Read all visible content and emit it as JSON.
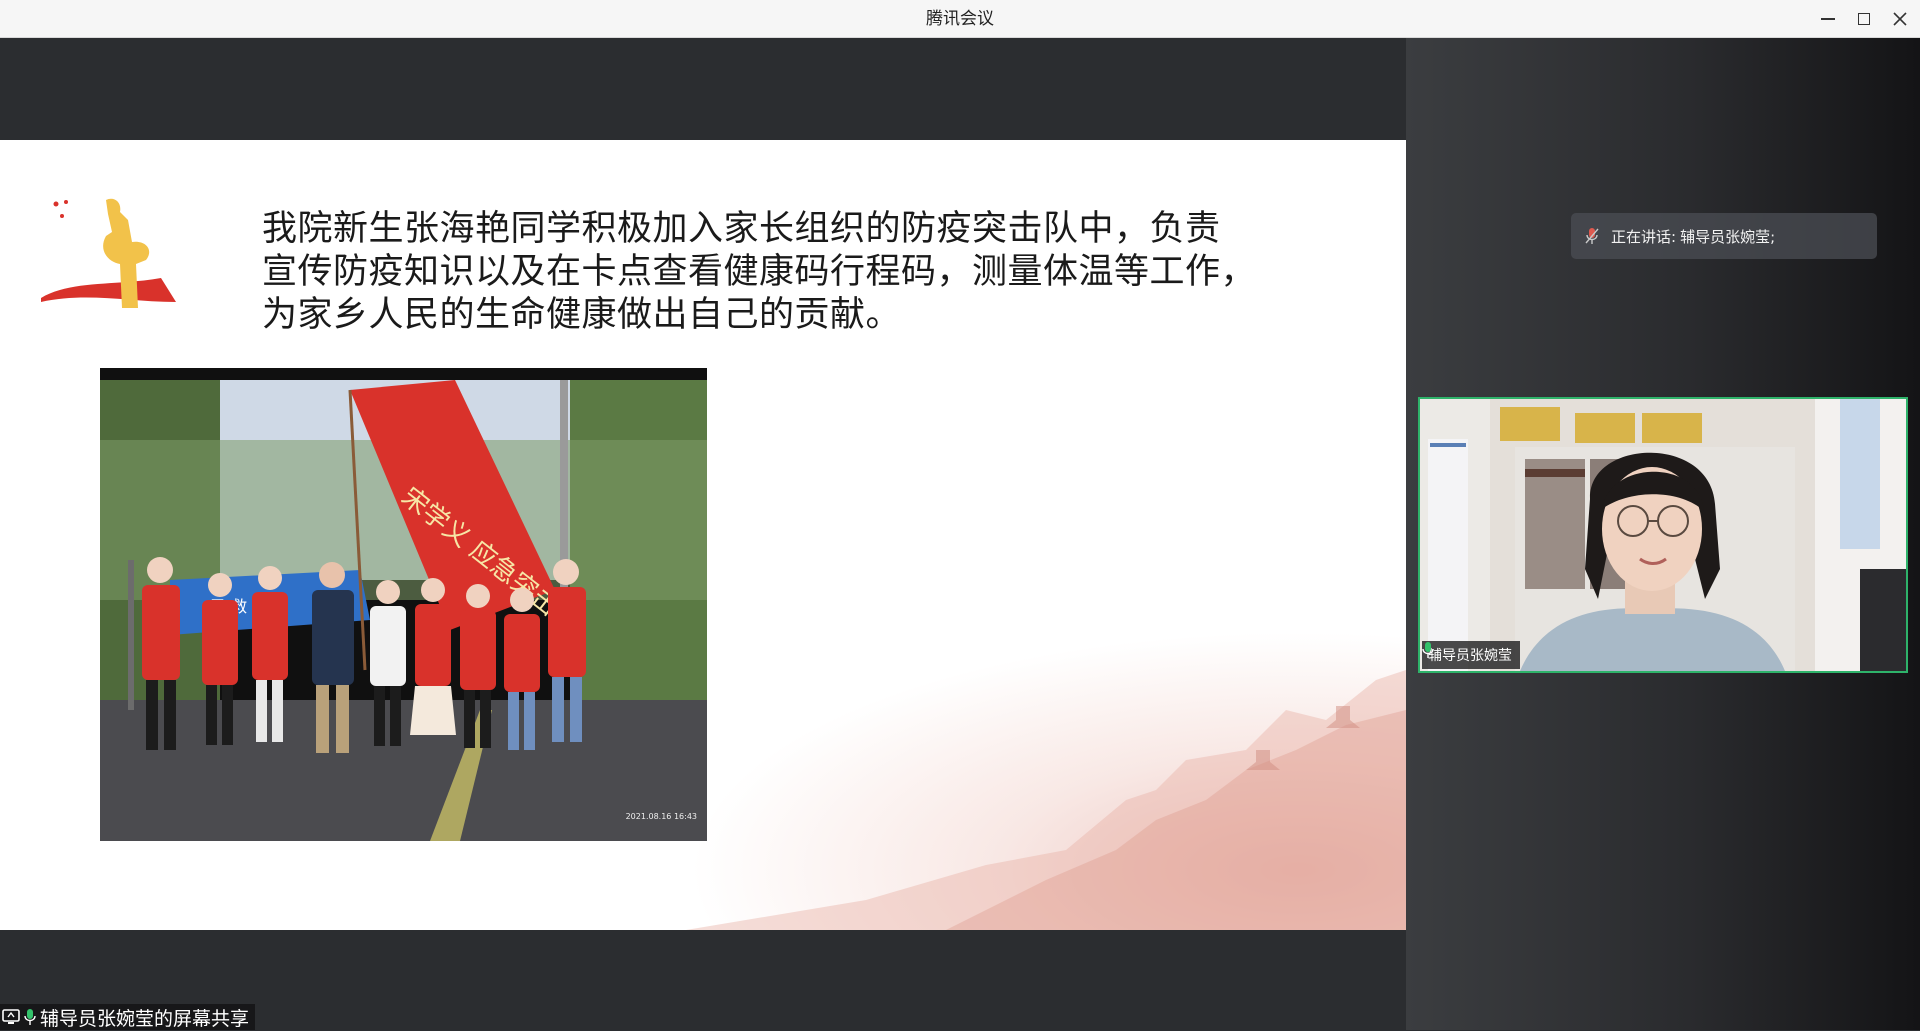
{
  "window": {
    "title": "腾讯会议"
  },
  "slide": {
    "paragraph_lines": [
      "我院新生张海艳同学积极加入家长组织的防疫突击队中，负责",
      "宣传防疫知识以及在卡点查看健康码行程码，测量体温等工作，",
      "为家乡人民的生命健康做出自己的贡献。"
    ],
    "photo": {
      "flag_text": "宋学义 应急突击队",
      "tent_text": "民 救 灾",
      "timestamp": "2021.08.16 16:43"
    }
  },
  "share_badge": {
    "label": "辅导员张婉莹的屏幕共享"
  },
  "speaking": {
    "prefix": "正在讲话:",
    "name": "辅导员张婉莹;"
  },
  "video_tile": {
    "name": "辅导员张婉莹"
  },
  "colors": {
    "active_speaker_border": "#2eb36a",
    "mic_active": "#33c26b",
    "mic_muted": "#e05a4f",
    "flag_red": "#d9322b"
  },
  "icons": {
    "minimize": "minimize-icon",
    "maximize": "maximize-icon",
    "close": "close-icon",
    "screen_share": "screen-share-icon",
    "mic": "mic-icon",
    "mic_muted": "mic-muted-icon"
  }
}
